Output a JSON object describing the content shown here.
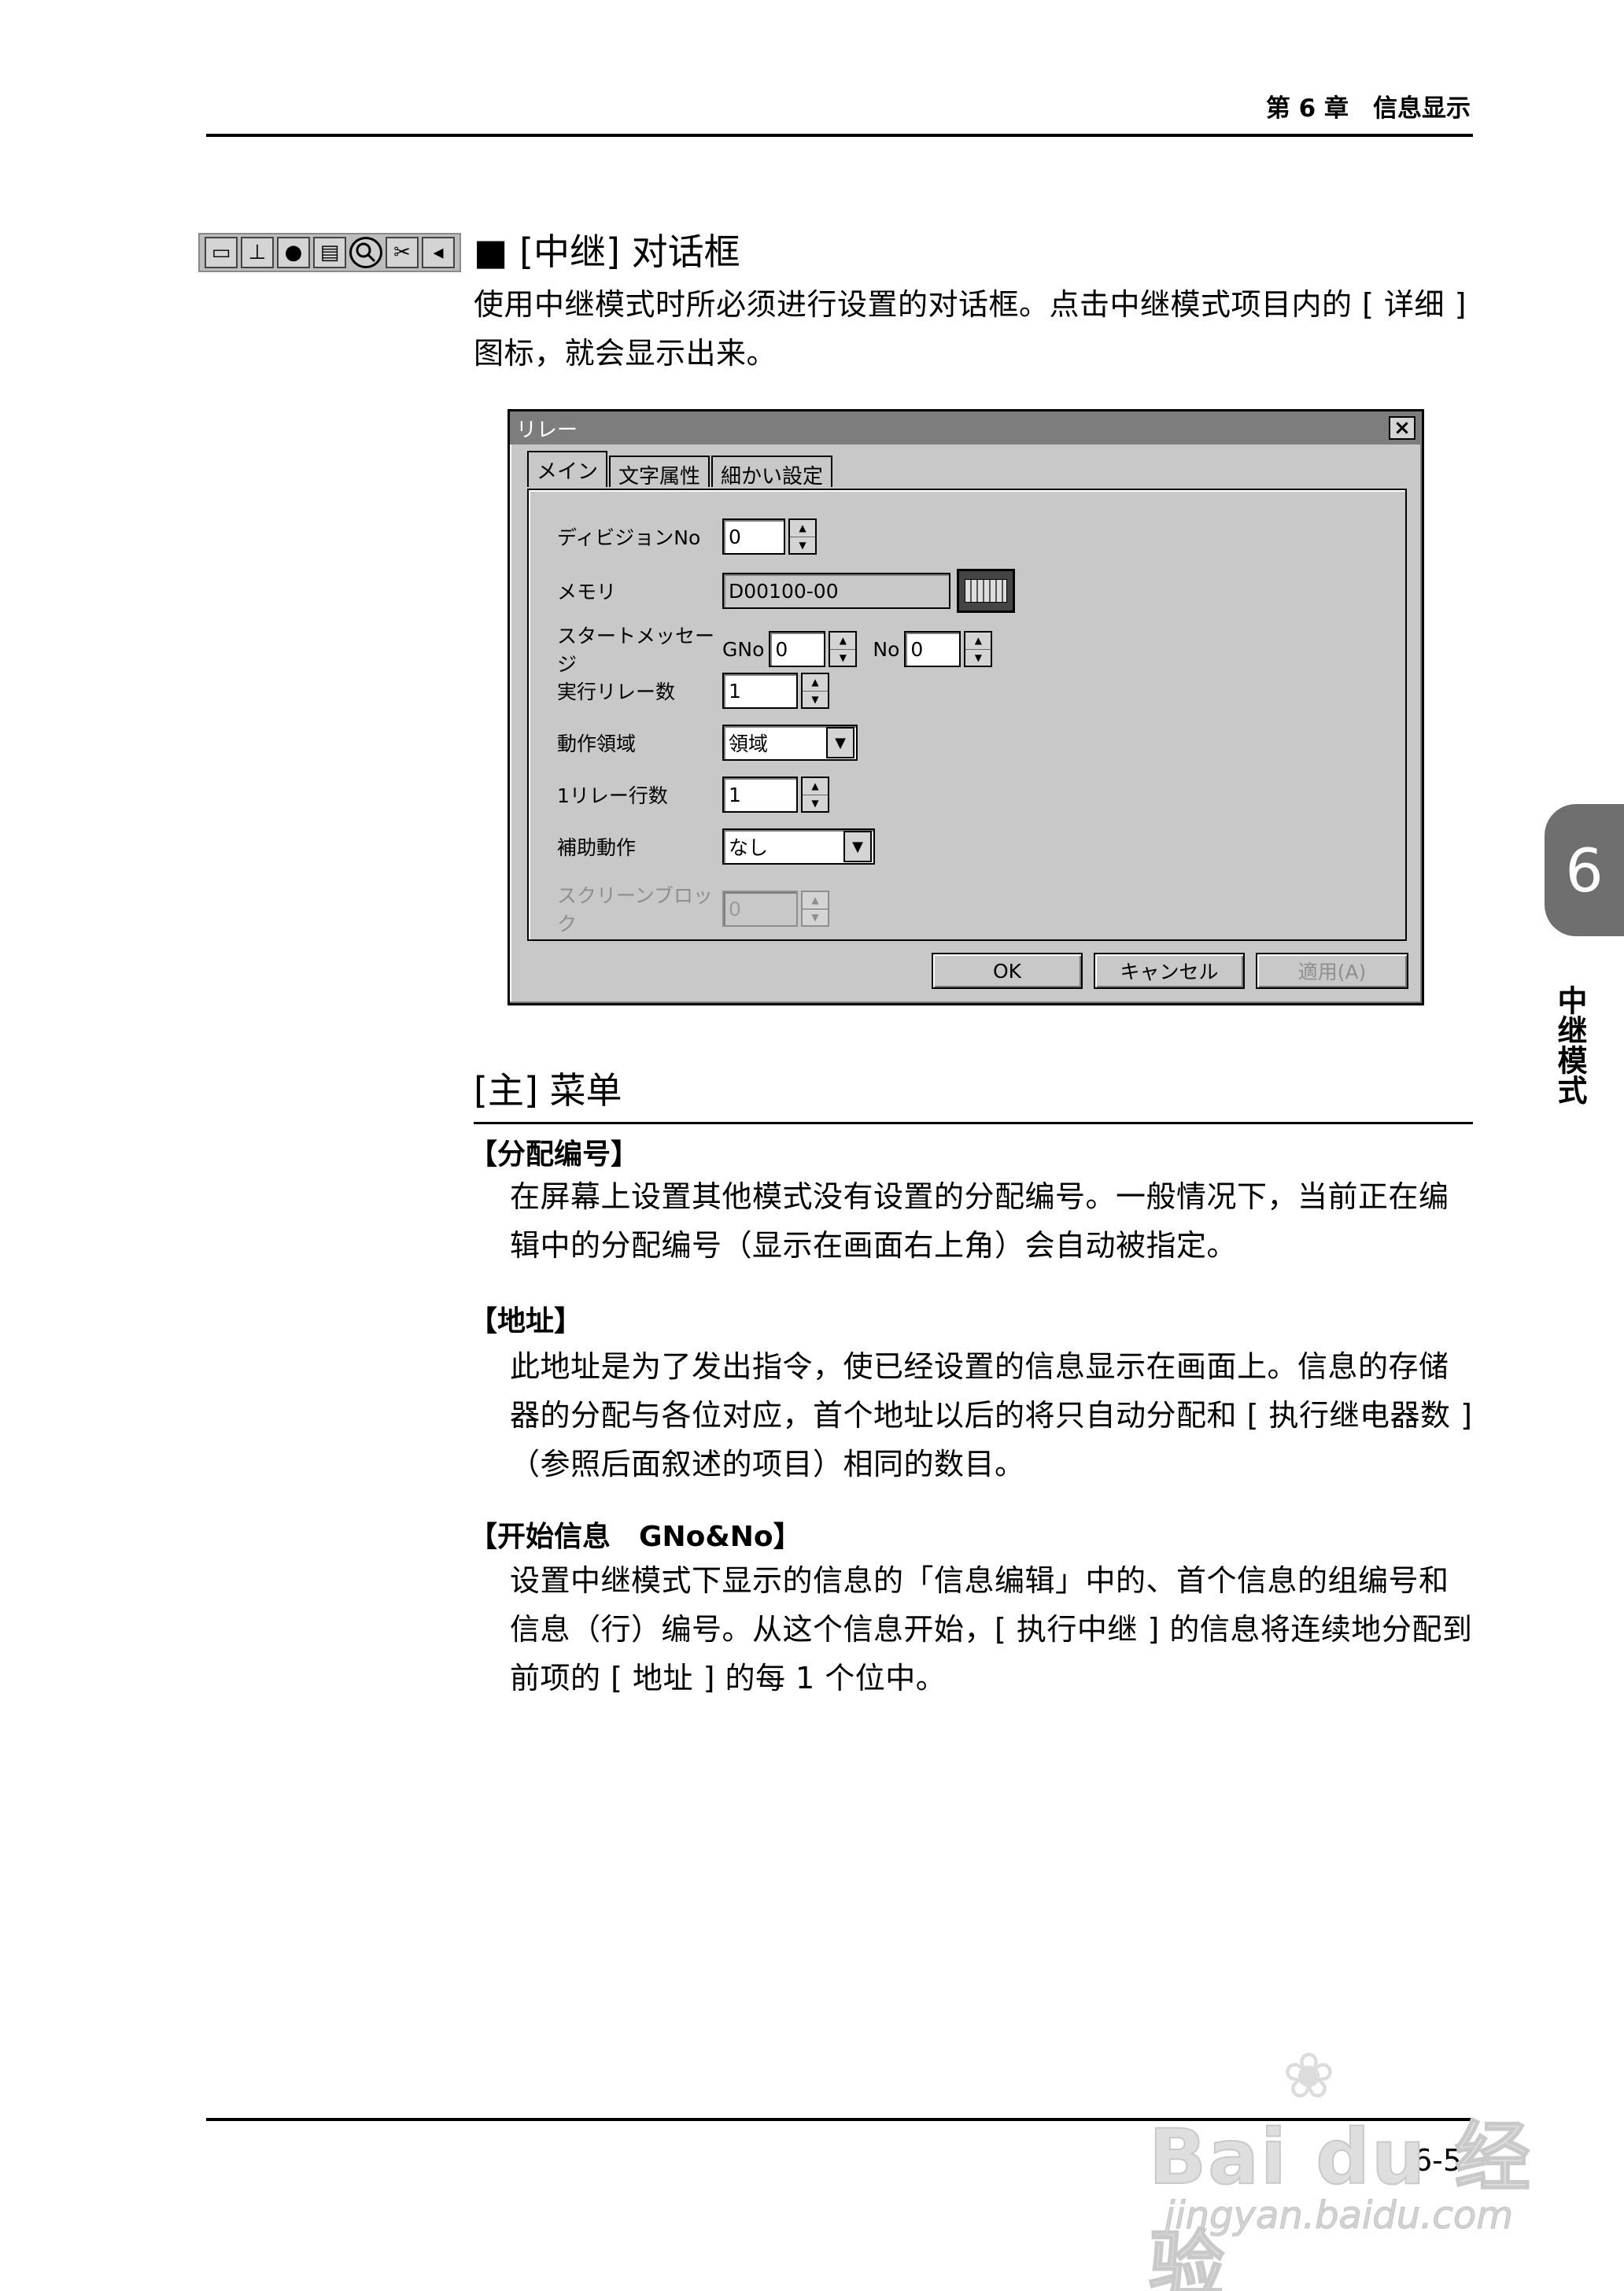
{
  "header": {
    "chapter": "第 6 章　信息显示"
  },
  "toolbar": {
    "icons": [
      "window-icon",
      "printer-icon",
      "bulb-icon",
      "list-icon",
      "magnifier-icon",
      "scissors-icon",
      "exit-icon"
    ],
    "glyphs": [
      "▭",
      "⊥",
      "●",
      "▤",
      "🔍",
      "✂",
      "◂"
    ]
  },
  "section": {
    "title": "■ [中继] 对话框",
    "intro": "使用中继模式时所必须进行设置的对话框。点击中继模式项目内的 [ 详细 ] 图标，就会显示出来。"
  },
  "dialog": {
    "title": "リレー",
    "close": "×",
    "tabs": [
      "メイン",
      "文字属性",
      "細かい設定"
    ],
    "rows": {
      "division_label": "ディビジョンNo",
      "division_value": "0",
      "memory_label": "メモリ",
      "memory_value": "D00100-00",
      "start_label": "スタートメッセージ",
      "gno_label": "GNo",
      "gno_value": "0",
      "no_label": "No",
      "no_value": "0",
      "exec_label": "実行リレー数",
      "exec_value": "1",
      "area_label": "動作領域",
      "area_value": "領域",
      "perline_label": "1リレー行数",
      "perline_value": "1",
      "aux_label": "補助動作",
      "aux_value": "なし",
      "screen_label": "スクリーンブロック",
      "screen_value": "0"
    },
    "buttons": {
      "ok": "OK",
      "cancel": "キャンセル",
      "apply": "適用(A)"
    },
    "spin_up": "▲",
    "spin_down": "▼",
    "dd_arrow": "▼"
  },
  "menu": {
    "title": "[主] 菜单",
    "items": [
      {
        "head": "【分配编号】",
        "body": "在屏幕上设置其他模式没有设置的分配编号。一般情况下，当前正在编辑中的分配编号（显示在画面右上角）会自动被指定。"
      },
      {
        "head": "【地址】",
        "body": "此地址是为了发出指令，使已经设置的信息显示在画面上。信息的存储器的分配与各位对应，首个地址以后的将只自动分配和 [ 执行继电器数 ]（参照后面叙述的项目）相同的数目。"
      },
      {
        "head": "【开始信息　GNo&No】",
        "body": "设置中继模式下显示的信息的「信息编辑」中的、首个信息的组编号和信息（行）编号。从这个信息开始，[ 执行中继 ] 的信息将连续地分配到前项的 [ 地址 ] 的每 1 个位中。"
      }
    ]
  },
  "side": {
    "chapter_number": "6",
    "chapter_name": "中继模式"
  },
  "footer": {
    "page": "6-5"
  },
  "watermark": {
    "paw": "❀",
    "brand": "Bai du 经验",
    "url": "jingyan.baidu.com"
  }
}
